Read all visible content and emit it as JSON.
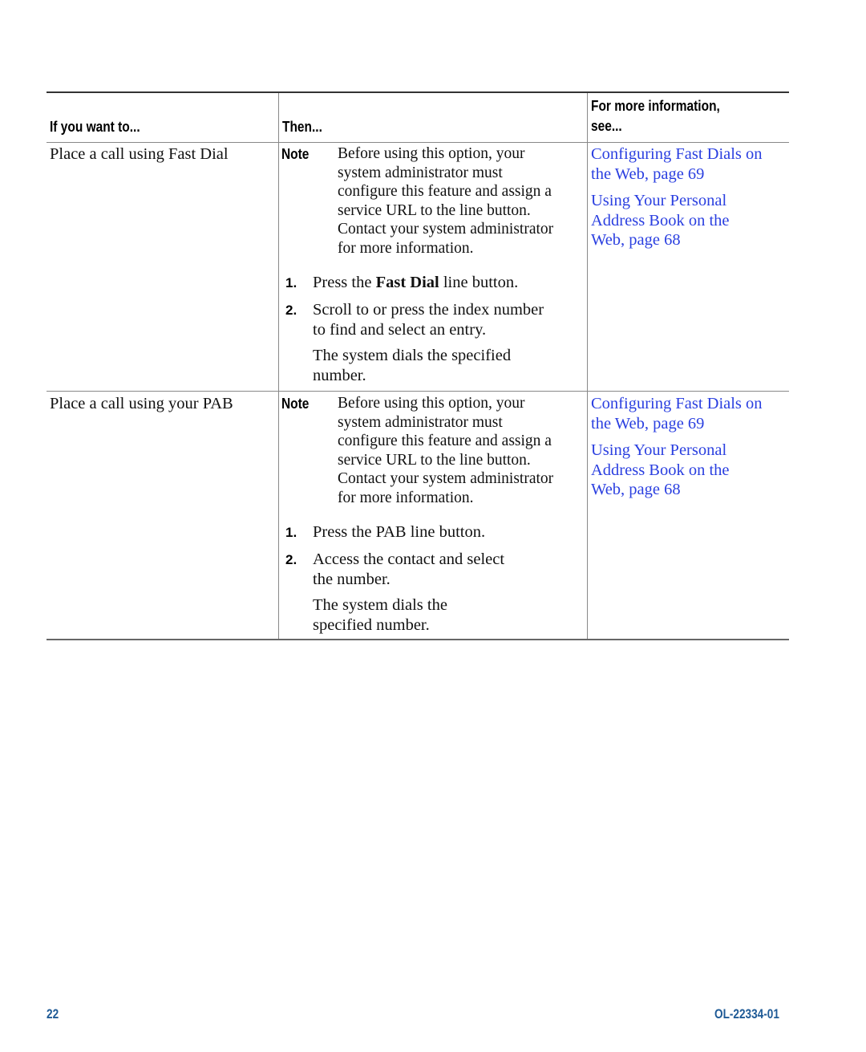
{
  "table": {
    "headers": {
      "col1": "If you want to...",
      "col2": "Then...",
      "col3_line1": "For more information,",
      "col3_line2": "see..."
    },
    "rows": [
      {
        "action": "Place a call using Fast Dial",
        "note_label": "Note",
        "note_lines": [
          "Before using this option, your",
          "system administrator must",
          "configure this feature and assign a",
          "service URL to the line button.",
          "Contact your system administrator",
          "for more information."
        ],
        "steps": [
          {
            "num": "1.",
            "pre": "Press the ",
            "bold": "Fast Dial",
            "post": " line button."
          },
          {
            "num": "2.",
            "line1": "Scroll to or press the index number",
            "line2": "to find and select an entry."
          }
        ],
        "result_lines": [
          "The system dials the specified",
          "number."
        ],
        "links": [
          {
            "line1": "Configuring Fast Dials on",
            "line2": "the Web, page 69"
          },
          {
            "line1": "Using Your Personal",
            "line2": "Address Book on the",
            "line3": "Web, page 68"
          }
        ]
      },
      {
        "action": "Place a call using your PAB",
        "note_label": "Note",
        "note_lines": [
          "Before using this option, your",
          "system administrator must",
          "configure this feature and assign a",
          "service URL to the line button.",
          "Contact your system administrator",
          "for more information."
        ],
        "steps": [
          {
            "num": "1.",
            "text": "Press the PAB line button."
          },
          {
            "num": "2.",
            "line1": "Access the contact and select",
            "line2": "the number."
          }
        ],
        "result_lines": [
          "The system dials the",
          "specified number."
        ],
        "links": [
          {
            "line1": "Configuring Fast Dials on",
            "line2": "the Web, page 69"
          },
          {
            "line1": "Using Your Personal",
            "line2": "Address Book on the",
            "line3": "Web, page 68"
          }
        ]
      }
    ]
  },
  "footer": {
    "page_number": "22",
    "doc_id": "OL-22334-01"
  },
  "colors": {
    "link": "#2a3fe0",
    "footer": "#1e5a96"
  }
}
